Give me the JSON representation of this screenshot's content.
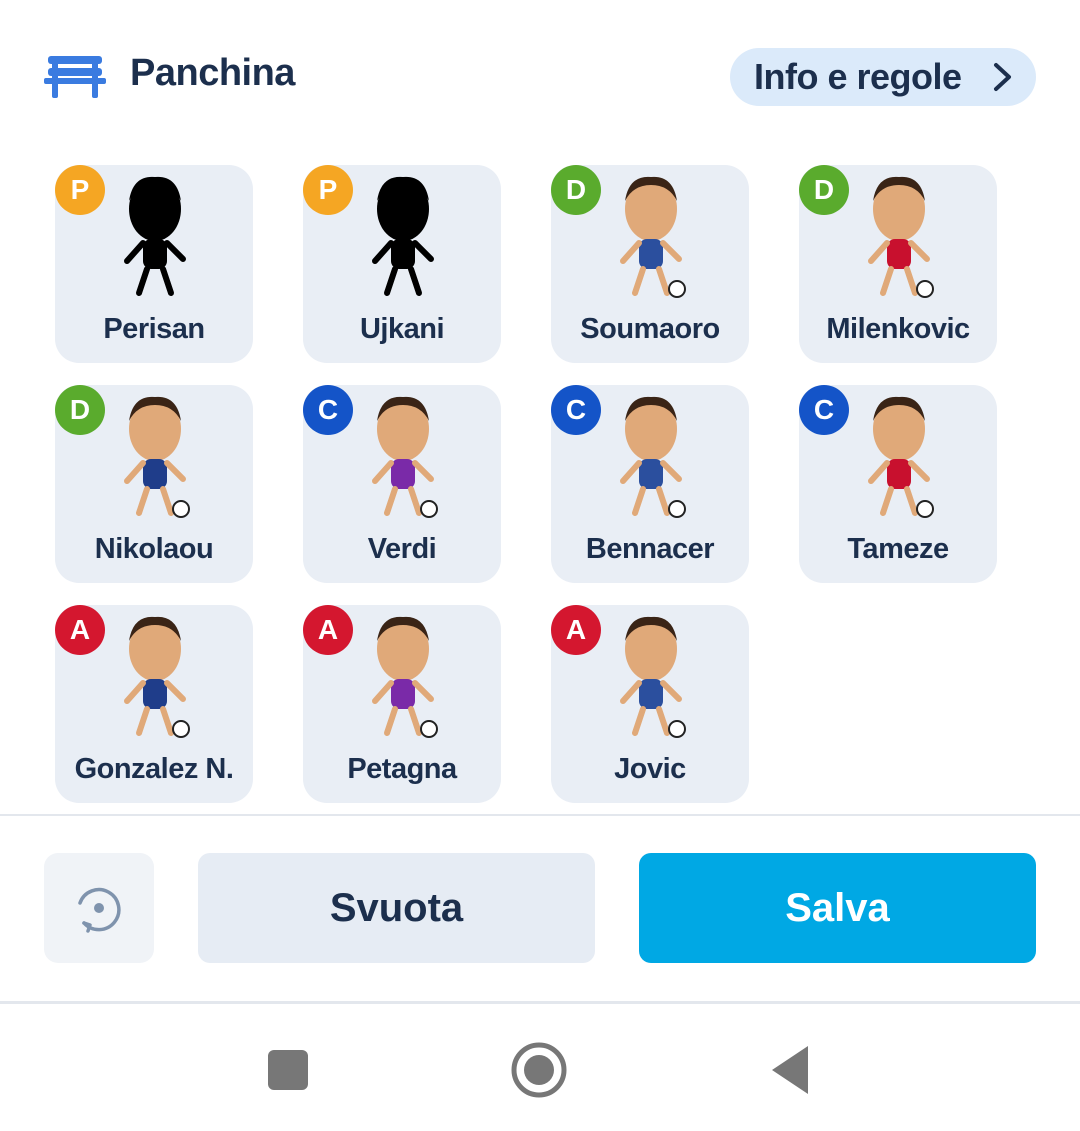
{
  "header": {
    "title": "Panchina",
    "info_label": "Info e regole",
    "bench_icon": "bench-icon",
    "chevron_icon": "chevron-right-icon"
  },
  "colors": {
    "role_P": "#f5a623",
    "role_D": "#5aab2d",
    "role_C": "#1454c8",
    "role_A": "#d4172f",
    "primary": "#00a8e4",
    "text_dark": "#1c2f4d"
  },
  "players": [
    {
      "role": "P",
      "name": "Perisan"
    },
    {
      "role": "P",
      "name": "Ujkani"
    },
    {
      "role": "D",
      "name": "Soumaoro"
    },
    {
      "role": "D",
      "name": "Milenkovic"
    },
    {
      "role": "D",
      "name": "Nikolaou"
    },
    {
      "role": "C",
      "name": "Verdi"
    },
    {
      "role": "C",
      "name": "Bennacer"
    },
    {
      "role": "C",
      "name": "Tameze"
    },
    {
      "role": "A",
      "name": "Gonzalez N."
    },
    {
      "role": "A",
      "name": "Petagna"
    },
    {
      "role": "A",
      "name": "Jovic"
    }
  ],
  "actions": {
    "reset_icon": "reset-icon",
    "clear_label": "Svuota",
    "save_label": "Salva"
  },
  "navbar": {
    "recents_icon": "recents-square-icon",
    "home_icon": "home-circle-icon",
    "back_icon": "back-triangle-icon"
  }
}
